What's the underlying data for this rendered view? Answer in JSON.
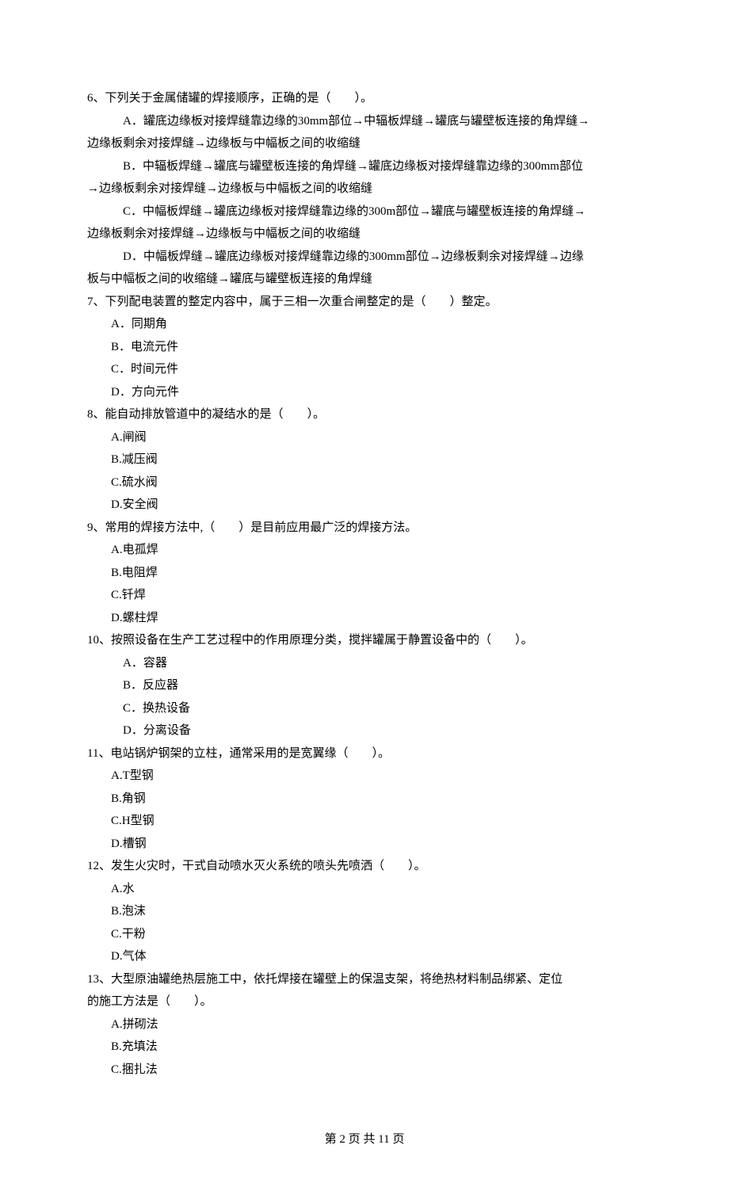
{
  "q6": {
    "stem": "6、下列关于金属储罐的焊接顺序，正确的是（　　）。",
    "a1": "A．罐底边缘板对接焊缝靠边缘的30mm部位→中辐板焊缝→罐底与罐壁板连接的角焊缝→",
    "a2": "边缘板剩余对接焊缝→边缘板与中幅板之间的收缩缝",
    "b1": "B．中辐板焊缝→罐底与罐壁板连接的角焊缝→罐底边缘板对接焊缝靠边缘的300mm部位",
    "b2": "→边缘板剩余对接焊缝→边缘板与中幅板之间的收缩缝",
    "c1": "C．中幅板焊缝→罐底边缘板对接焊缝靠边缘的300m部位→罐底与罐壁板连接的角焊缝→",
    "c2": "边缘板剩余对接焊缝→边缘板与中幅板之间的收缩缝",
    "d1": "D．中幅板焊缝→罐底边缘板对接焊缝靠边缘的300mm部位→边缘板剩余对接焊缝→边缘",
    "d2": "板与中幅板之间的收缩缝→罐底与罐壁板连接的角焊缝"
  },
  "q7": {
    "stem": "7、下列配电装置的整定内容中，属于三相一次重合闸整定的是（　　）整定。",
    "a": "A．同期角",
    "b": "B．电流元件",
    "c": "C．时间元件",
    "d": "D．方向元件"
  },
  "q8": {
    "stem": "8、能自动排放管道中的凝结水的是（　　）。",
    "a": "A.闸阀",
    "b": "B.减压阀",
    "c": "C.硫水阀",
    "d": "D.安全阀"
  },
  "q9": {
    "stem": "9、常用的焊接方法中,（　　）是目前应用最广泛的焊接方法。",
    "a": "A.电孤焊",
    "b": "B.电阻焊",
    "c": "C.钎焊",
    "d": "D.螺柱焊"
  },
  "q10": {
    "stem": "10、按照设备在生产工艺过程中的作用原理分类，搅拌罐属于静置设备中的（　　）。",
    "a": "A．容器",
    "b": "B．反应器",
    "c": "C．换热设备",
    "d": "D．分离设备"
  },
  "q11": {
    "stem": "11、电站锅炉钢架的立柱，通常采用的是宽翼缘（　　）。",
    "a": "A.T型钢",
    "b": "B.角钢",
    "c": "C.H型钢",
    "d": "D.槽钢"
  },
  "q12": {
    "stem": "12、发生火灾时，干式自动喷水灭火系统的喷头先喷洒（　　）。",
    "a": "A.水",
    "b": "B.泡沫",
    "c": "C.干粉",
    "d": "D.气体"
  },
  "q13": {
    "stem1": "13、大型原油罐绝热层施工中，依托焊接在罐壁上的保温支架，将绝热材料制品绑紧、定位",
    "stem2": "的施工方法是（　　）。",
    "a": "A.拼砌法",
    "b": "B.充填法",
    "c": "C.捆扎法"
  },
  "footer": "第 2 页 共 11 页"
}
